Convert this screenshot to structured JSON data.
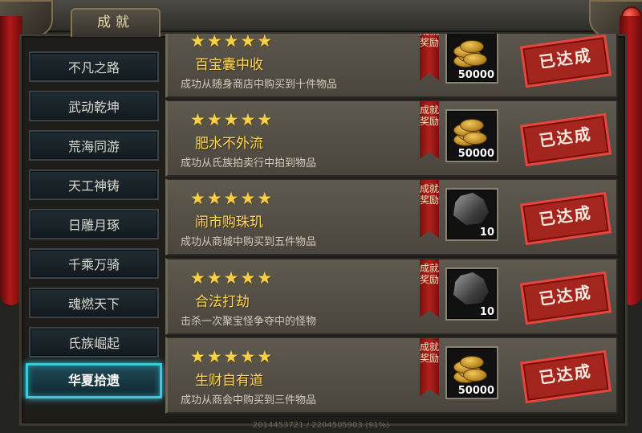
{
  "window": {
    "title": "成就"
  },
  "sidebar": {
    "items": [
      {
        "label": "不凡之路",
        "active": false
      },
      {
        "label": "武动乾坤",
        "active": false
      },
      {
        "label": "荒海同游",
        "active": false
      },
      {
        "label": "天工神铸",
        "active": false
      },
      {
        "label": "日雕月琢",
        "active": false
      },
      {
        "label": "千乘万骑",
        "active": false
      },
      {
        "label": "魂燃天下",
        "active": false
      },
      {
        "label": "氏族崛起",
        "active": false
      },
      {
        "label": "华夏拾遗",
        "active": true
      }
    ]
  },
  "reward_ribbon_label": "成就奖励",
  "achievements": [
    {
      "stars": 5,
      "name": "百宝囊中收",
      "desc": "成功从随身商店中购买到十件物品",
      "reward_icon": "gold-coins-icon",
      "reward_qty": "50000",
      "status": "已达成"
    },
    {
      "stars": 5,
      "name": "肥水不外流",
      "desc": "成功从氏族拍卖行中拍到物品",
      "reward_icon": "gold-coins-icon",
      "reward_qty": "50000",
      "status": "已达成"
    },
    {
      "stars": 5,
      "name": "闹市购珠玑",
      "desc": "成功从商城中购买到五件物品",
      "reward_icon": "ore-icon",
      "reward_qty": "10",
      "status": "已达成"
    },
    {
      "stars": 5,
      "name": "合法打劫",
      "desc": "击杀一次聚宝怪争夺中的怪物",
      "reward_icon": "ore-icon",
      "reward_qty": "10",
      "status": "已达成"
    },
    {
      "stars": 5,
      "name": "生财自有道",
      "desc": "成功从商会中购买到三件物品",
      "reward_icon": "gold-coins-icon",
      "reward_qty": "50000",
      "status": "已达成"
    }
  ],
  "footer": {
    "text": "2014453721 / 2204505903 (91%)"
  },
  "colors": {
    "accent_active": "#3cc8dd",
    "star": "#f7d04a",
    "name": "#ffd75a",
    "stamp": "#b21e18"
  }
}
